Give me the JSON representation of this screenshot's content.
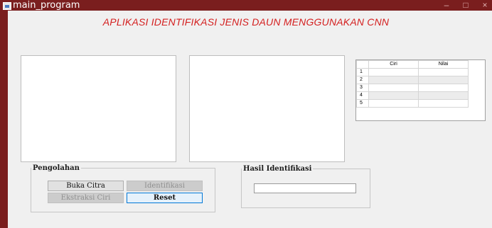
{
  "window": {
    "title": "main_program",
    "controls": {
      "minimize": "–",
      "maximize": "□",
      "close": "×"
    }
  },
  "app": {
    "heading": "APLIKASI IDENTIFIKASI JENIS DAUN MENGGUNAKAN CNN"
  },
  "table": {
    "columns": [
      "Ciri",
      "Nilai"
    ],
    "rows": [
      "1",
      "2",
      "3",
      "4",
      "5"
    ]
  },
  "pengolahan": {
    "title": "Pengolahan",
    "buka_citra": "Buka Citra",
    "identifikasi": "Identifikasi",
    "ekstraksi_ciri": "Ekstraksi Ciri",
    "reset": "Reset"
  },
  "hasil": {
    "title": "Hasil Identifikasi",
    "value": ""
  },
  "colors": {
    "titlebar": "#7a1e1e",
    "heading": "#d42020"
  }
}
